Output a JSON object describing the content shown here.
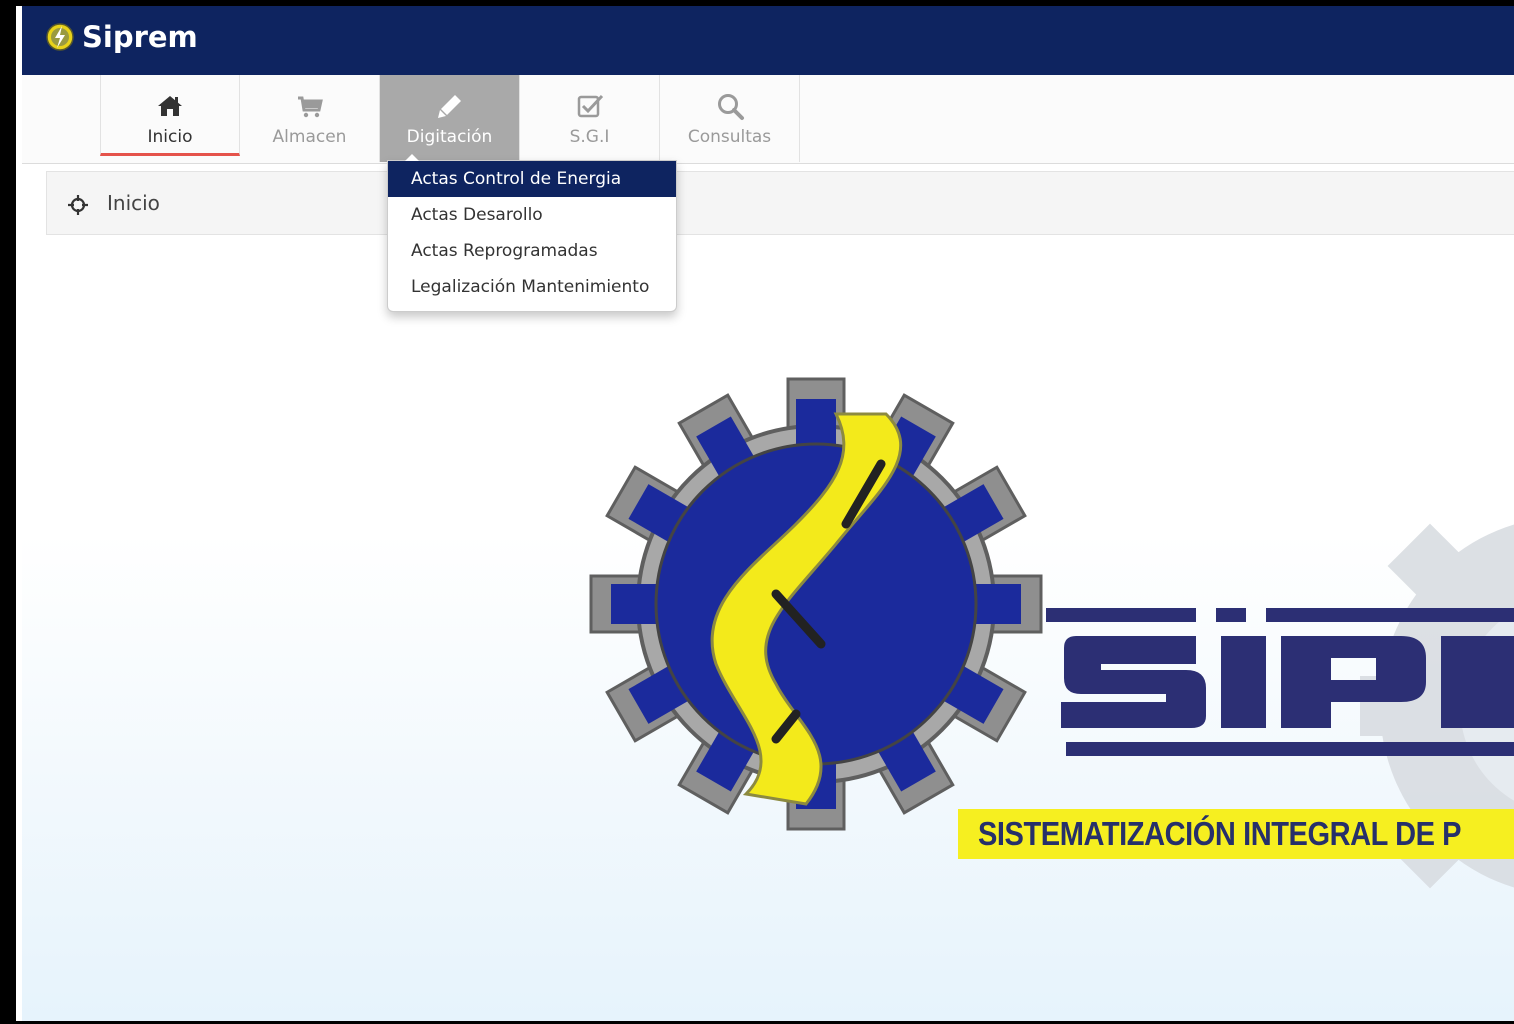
{
  "app": {
    "name": "Siprem",
    "logo_icon": "siprem-bolt-icon",
    "accent_color": "#0e2460"
  },
  "menu": {
    "items": [
      {
        "label": "Inicio",
        "icon": "home-icon"
      },
      {
        "label": "Almacen",
        "icon": "cart-icon"
      },
      {
        "label": "Digitación",
        "icon": "pencil-icon"
      },
      {
        "label": "S.G.I",
        "icon": "checkbox-icon"
      },
      {
        "label": "Consultas",
        "icon": "search-icon"
      }
    ],
    "active": "Inicio",
    "open": "Digitación"
  },
  "dropdown": {
    "items": [
      {
        "label": "Actas Control de Energia",
        "selected": true
      },
      {
        "label": "Actas Desarollo",
        "selected": false
      },
      {
        "label": "Actas Reprogramadas",
        "selected": false
      },
      {
        "label": "Legalización Mantenimiento",
        "selected": false
      }
    ]
  },
  "breadcrumb": {
    "label": "Inicio",
    "icon": "crosshair-icon"
  },
  "banner": {
    "tagline": "SISTEMATIZACIÓN INTEGRAL DE P"
  }
}
